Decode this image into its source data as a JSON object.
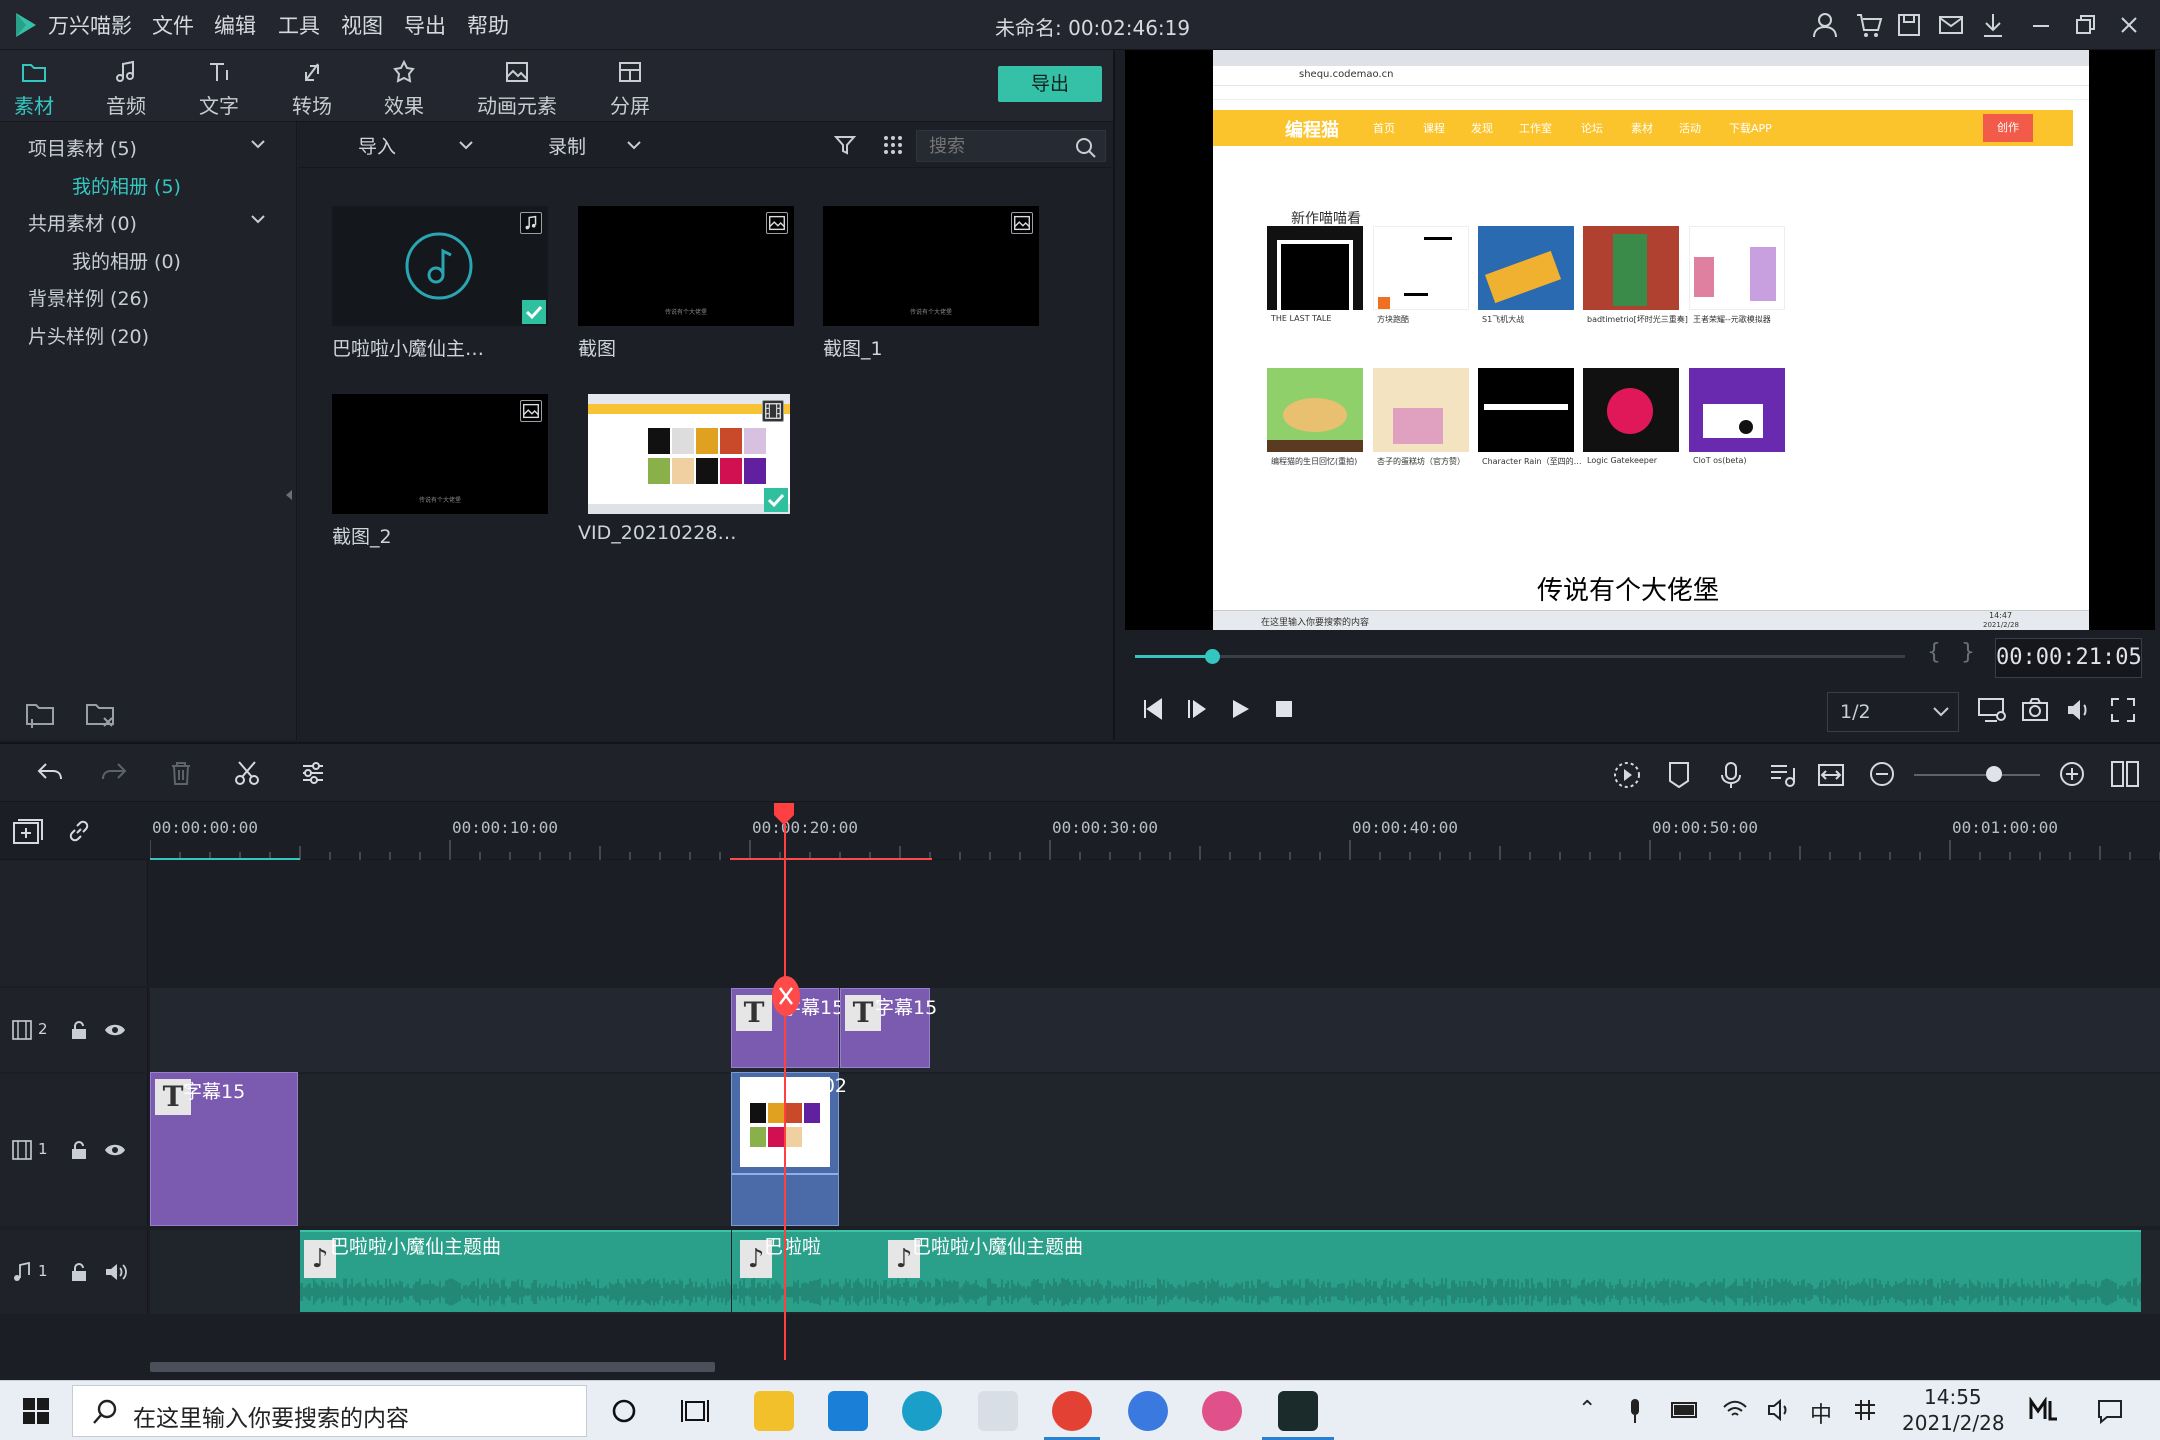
{
  "titlebar": {
    "app_name": "万兴喵影",
    "menus": [
      "文件",
      "编辑",
      "工具",
      "视图",
      "导出",
      "帮助"
    ],
    "doc_title": "未命名: 00:02:46:19"
  },
  "tabs": [
    {
      "label": "素材",
      "icon": "folder-icon"
    },
    {
      "label": "音频",
      "icon": "music-icon"
    },
    {
      "label": "文字",
      "icon": "text-icon"
    },
    {
      "label": "转场",
      "icon": "transition-icon"
    },
    {
      "label": "效果",
      "icon": "effects-icon"
    },
    {
      "label": "动画元素",
      "icon": "image-icon"
    },
    {
      "label": "分屏",
      "icon": "split-screen-icon"
    }
  ],
  "export_label": "导出",
  "sidebar": {
    "items": [
      {
        "label": "项目素材 (5)"
      },
      {
        "label": "我的相册 (5)"
      },
      {
        "label": "共用素材 (0)"
      },
      {
        "label": "我的相册 (0)"
      },
      {
        "label": "背景样例 (26)"
      },
      {
        "label": "片头样例 (20)"
      }
    ]
  },
  "media_bar": {
    "import_label": "导入",
    "record_label": "录制",
    "search_placeholder": "搜索"
  },
  "media_items": [
    {
      "label": "巴啦啦小魔仙主…",
      "type": "audio"
    },
    {
      "label": "截图",
      "type": "image",
      "caption": "传说有个大佬堡"
    },
    {
      "label": "截图_1",
      "type": "image",
      "caption": "传说有个大佬堡"
    },
    {
      "label": "截图_2",
      "type": "image",
      "caption": "传说有个大佬堡"
    },
    {
      "label": "VID_20210228…",
      "type": "video"
    }
  ],
  "preview": {
    "browser_url": "shequ.codemao.cn",
    "site_logo": "编程猫",
    "site_nav": [
      "首页",
      "课程",
      "发现",
      "工作室",
      "论坛",
      "素材",
      "活动",
      "下载APP"
    ],
    "create_btn": "创作",
    "section_title": "新作喵喵看",
    "cards_row1": [
      "THE LAST TALE",
      "方块跑酷",
      "S1飞机大战",
      "badtimetrio[坏时光三重奏]",
      "王者荣耀--元歌模拟器"
    ],
    "cards_row2": [
      "编程猫的生日回忆(重拍)",
      "杏子的蛋糕坊（官方赞）",
      "Character Rain（至四的…",
      "Logic Gatekeeper",
      "CloT os(beta)"
    ],
    "win_search": "在这里输入你要搜索的内容",
    "win_time": "14:47",
    "win_date": "2021/2/28",
    "subtitle": "传说有个大佬堡",
    "progress": 0.1,
    "timecode": "00:00:21:05",
    "ratio": "1/2"
  },
  "ruler": {
    "labels": [
      "00:00:00:00",
      "00:00:10:00",
      "00:00:20:00",
      "00:00:30:00",
      "00:00:40:00",
      "00:00:50:00",
      "00:01:00:00"
    ]
  },
  "tracks": {
    "video2_label": "2",
    "video1_label": "1",
    "audio1_label": "1",
    "clip_subtitle_a": "字幕15",
    "clip_subtitle_b": "字幕15",
    "clip_subtitle_c": "字幕15",
    "clip_video": "VID_202",
    "audio_a": "巴啦啦小魔仙主题曲",
    "audio_b": "巴啦啦",
    "audio_c": "巴啦啦小魔仙主题曲"
  },
  "taskbar": {
    "search_placeholder": "在这里输入你要搜索的内容",
    "ime": "中",
    "time": "14:55",
    "date": "2021/2/28"
  },
  "colors": {
    "accent": "#36c6c0",
    "export": "#35c0a8",
    "subtitle_clip": "#7b5bb0",
    "audio_clip": "#2a9f8a",
    "playhead": "#ff4040"
  }
}
